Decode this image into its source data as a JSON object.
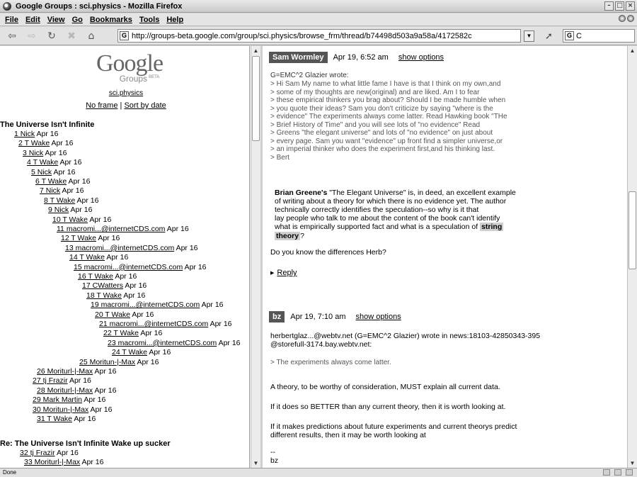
{
  "window": {
    "title": "Google Groups : sci.physics - Mozilla Firefox",
    "buttons": [
      "–",
      "□",
      "×"
    ]
  },
  "menu": [
    "File",
    "Edit",
    "View",
    "Go",
    "Bookmarks",
    "Tools",
    "Help"
  ],
  "nav": {
    "url": "http://groups-beta.google.com/group/sci.physics/browse_frm/thread/b74498d503a9a58a/4172582c",
    "search_value": "C"
  },
  "left": {
    "logo_text": "Google",
    "logo_sub": "Groups",
    "logo_beta": "BETA",
    "group_name": "sci.physics",
    "no_frame": "No frame",
    "sep": "|",
    "sort_by_date": "Sort by date",
    "thread1_title": "The Universe Isn't Infinite",
    "thread2_title": "Re: The Universe Isn't Infinite Wake up sucker",
    "tree": [
      {
        "link": "1 Nick",
        "date": "Apr 16"
      },
      {
        "link": "2 T Wake",
        "date": "Apr 16"
      },
      {
        "link": "3 Nick",
        "date": "Apr 16"
      },
      {
        "link": "4 T Wake",
        "date": "Apr 16"
      },
      {
        "link": "5 Nick",
        "date": "Apr 16"
      },
      {
        "link": "6 T Wake",
        "date": "Apr 16"
      },
      {
        "link": "7 Nick",
        "date": "Apr 16"
      },
      {
        "link": "8 T Wake",
        "date": "Apr 16"
      },
      {
        "link": "9 Nick",
        "date": "Apr 16"
      },
      {
        "link": "10 T Wake",
        "date": "Apr 16"
      },
      {
        "link": "11 macromi...@internetCDS.com",
        "date": "Apr 16"
      },
      {
        "link": "12 T Wake",
        "date": "Apr 16"
      },
      {
        "link": "13 macromi...@internetCDS.com",
        "date": "Apr 16"
      },
      {
        "link": "14 T Wake",
        "date": "Apr 16"
      },
      {
        "link": "15 macromi...@internetCDS.com",
        "date": "Apr 16"
      },
      {
        "link": "16 T Wake",
        "date": "Apr 16"
      },
      {
        "link": "17 CWatters",
        "date": "Apr 16"
      },
      {
        "link": "18 T Wake",
        "date": "Apr 16"
      },
      {
        "link": "19 macromi...@internetCDS.com",
        "date": "Apr 16"
      },
      {
        "link": "20 T Wake",
        "date": "Apr 16"
      },
      {
        "link": "21 macromi...@internetCDS.com",
        "date": "Apr 16"
      },
      {
        "link": "22 T Wake",
        "date": "Apr 16"
      },
      {
        "link": "23 macromi...@internetCDS.com",
        "date": "Apr 16"
      },
      {
        "link": "24 T Wake",
        "date": "Apr 16"
      },
      {
        "link": "25 Moritun-|-Max",
        "date": "Apr 16"
      },
      {
        "link": "26 Moriturl-|-Max",
        "date": "Apr 16"
      },
      {
        "link": "27 tj Frazir",
        "date": "Apr 16"
      },
      {
        "link": "28 Moriturl-|-Max",
        "date": "Apr 16"
      },
      {
        "link": "29 Mark Martin",
        "date": "Apr 16"
      },
      {
        "link": "30 Moritun-|-Max",
        "date": "Apr 16"
      },
      {
        "link": "31 T Wake",
        "date": "Apr 16"
      },
      {
        "link": "32 tj Frazir",
        "date": "Apr 16"
      },
      {
        "link": "33 Moriturl-|-Max",
        "date": "Apr 16"
      }
    ]
  },
  "msg1": {
    "author": "Sam Wormley",
    "date": "Apr 19, 6:52 am",
    "show_options": "show options",
    "intro": "G=EMC^2 Glazier wrote:",
    "quote": [
      "> Hi Sam  My name to what little fame I have is that I think on my own,and",
      "> some of my thoughts are new(original) and are liked.    Am I to fear",
      "> these empirical thinkers you brag about? Should I be made humble when",
      "> you quote their ideas?  Sam you don't criticize by saying \"where is the",
      "> evidence\" The experiments always come latter.  Read Hawking book \"THe",
      "> Brief History of Time\" and you will see lots of \"no evidence\"  Read",
      "> Greens \"the elegant universe\" and lots of \"no evidence\" on just about",
      "> every page.  Sam you want \"evidence\" up front find a simpler universe,or",
      "> an imperial thinker who does the experiment first,and his thinking last.",
      "> Bert"
    ],
    "body_lead": "Brian Greene's",
    "body_l1": " \"The Elegant Universe\" is, in deed, an excellent example",
    "body_l2": "of writing about a theory for which there is no evidence yet. The author",
    "body_l3": "technically correctly identifies the speculation--so why is it that",
    "body_l4": "lay people who talk to me about the content of the book can't identify",
    "body_l5": "what is empirically supported fact and what is a speculation of",
    "hl1": "string",
    "hl2": "theory",
    "qmark": "?",
    "question": "Do you know the differences Herb?",
    "reply": "Reply"
  },
  "msg2": {
    "author": "bz",
    "date": "Apr 19, 7:10 am",
    "show_options": "show options",
    "header_l1": "herbertglaz...@webtv.net (G=EMC^2 Glazier) wrote in news:18103-42850343-395",
    "header_l2": "@storefull-3174.bay.webtv.net:",
    "quote": "> The experiments always come latter.",
    "p1": "A theory, to be worthy of consideration, MUST explain all current data.",
    "p2": "If it does so BETTER than any current theory, then it is worth looking at.",
    "p3a": "If it makes predictions about future experiments and current theorys predict",
    "p3b": "different results, then it may be worth looking at",
    "sig_dash": "--",
    "sig": "bz"
  },
  "status": {
    "text": "Done"
  }
}
